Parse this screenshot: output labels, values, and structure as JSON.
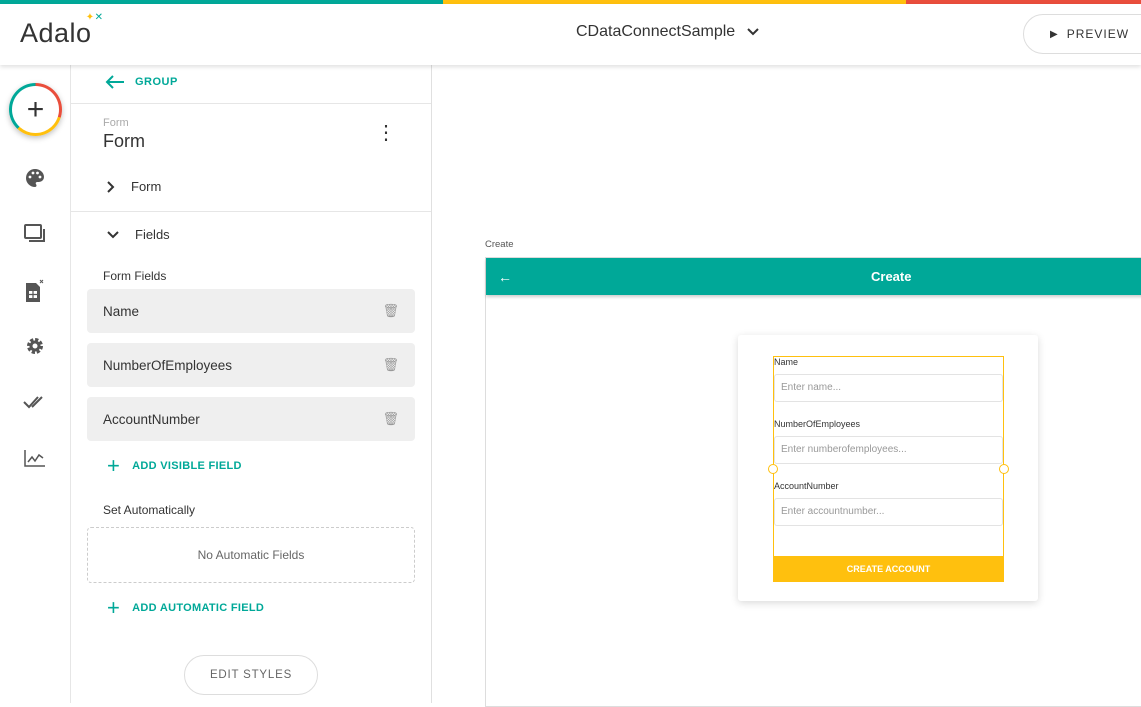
{
  "colors": {
    "teal": "#00a898",
    "yellow": "#ffc00e",
    "red": "#e94e3c"
  },
  "header": {
    "logo": "Adalo",
    "app_name": "CDataConnectSample",
    "preview_label": "PREVIEW"
  },
  "rail": {
    "icons": [
      "add-icon",
      "palette-icon",
      "screens-icon",
      "database-icon",
      "settings-icon",
      "publish-icon",
      "analytics-icon"
    ]
  },
  "panel": {
    "back_label": "GROUP",
    "component_type": "Form",
    "component_name": "Form",
    "sections": {
      "form": "Form",
      "fields": "Fields"
    },
    "form_fields_label": "Form Fields",
    "fields": [
      {
        "label": "Name"
      },
      {
        "label": "NumberOfEmployees"
      },
      {
        "label": "AccountNumber"
      }
    ],
    "add_visible_field": "ADD VISIBLE FIELD",
    "set_automatically_label": "Set Automatically",
    "no_automatic_fields": "No Automatic Fields",
    "add_automatic_field": "ADD AUTOMATIC FIELD",
    "edit_styles": "EDIT STYLES"
  },
  "canvas": {
    "screen_label": "Create",
    "appbar_title": "Create",
    "form": {
      "fields": [
        {
          "label": "Name",
          "placeholder": "Enter name..."
        },
        {
          "label": "NumberOfEmployees",
          "placeholder": "Enter numberofemployees..."
        },
        {
          "label": "AccountNumber",
          "placeholder": "Enter accountnumber..."
        }
      ],
      "submit_label": "CREATE ACCOUNT"
    }
  }
}
